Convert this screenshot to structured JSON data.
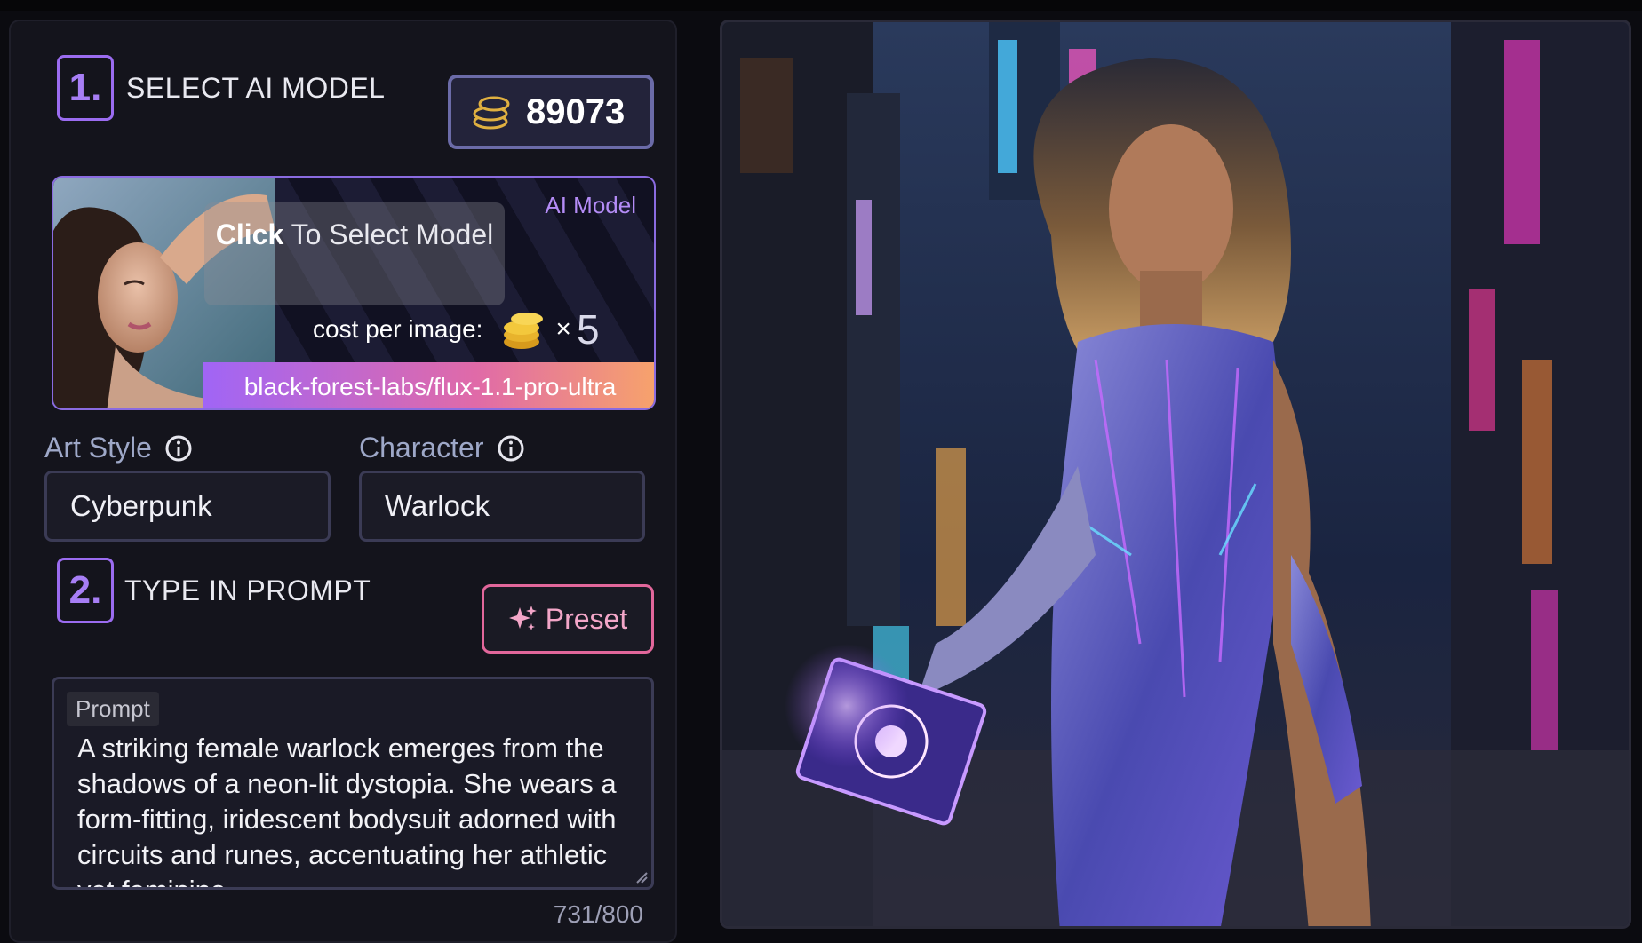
{
  "credits": {
    "balance": "89073",
    "icon": "coins-icon"
  },
  "step1": {
    "number": "1.",
    "title": "SELECT AI MODEL"
  },
  "model_card": {
    "click_bold": "Click",
    "click_rest": " To Select Model",
    "type_label": "AI Model",
    "cost_label": "cost per image:",
    "cost_multiplier": "×",
    "cost_value": "5",
    "model_name": "black-forest-labs/flux-1.1-pro-ultra"
  },
  "art_style": {
    "label": "Art Style",
    "value": "Cyberpunk"
  },
  "character": {
    "label": "Character",
    "value": "Warlock"
  },
  "step2": {
    "number": "2.",
    "title": "TYPE IN PROMPT"
  },
  "preset": {
    "label": "Preset",
    "icon": "sparkles-icon"
  },
  "prompt": {
    "tag": "Prompt",
    "text": "A striking female warlock emerges from the shadows of a neon-lit dystopia. She wears a form-fitting, iridescent bodysuit adorned with circuits and runes, accentuating her athletic yet feminine",
    "counter": "731/800"
  },
  "colors": {
    "accent_purple": "#9b6cf0",
    "preset_pink": "#e2679b",
    "panel_bg": "#14141c"
  }
}
